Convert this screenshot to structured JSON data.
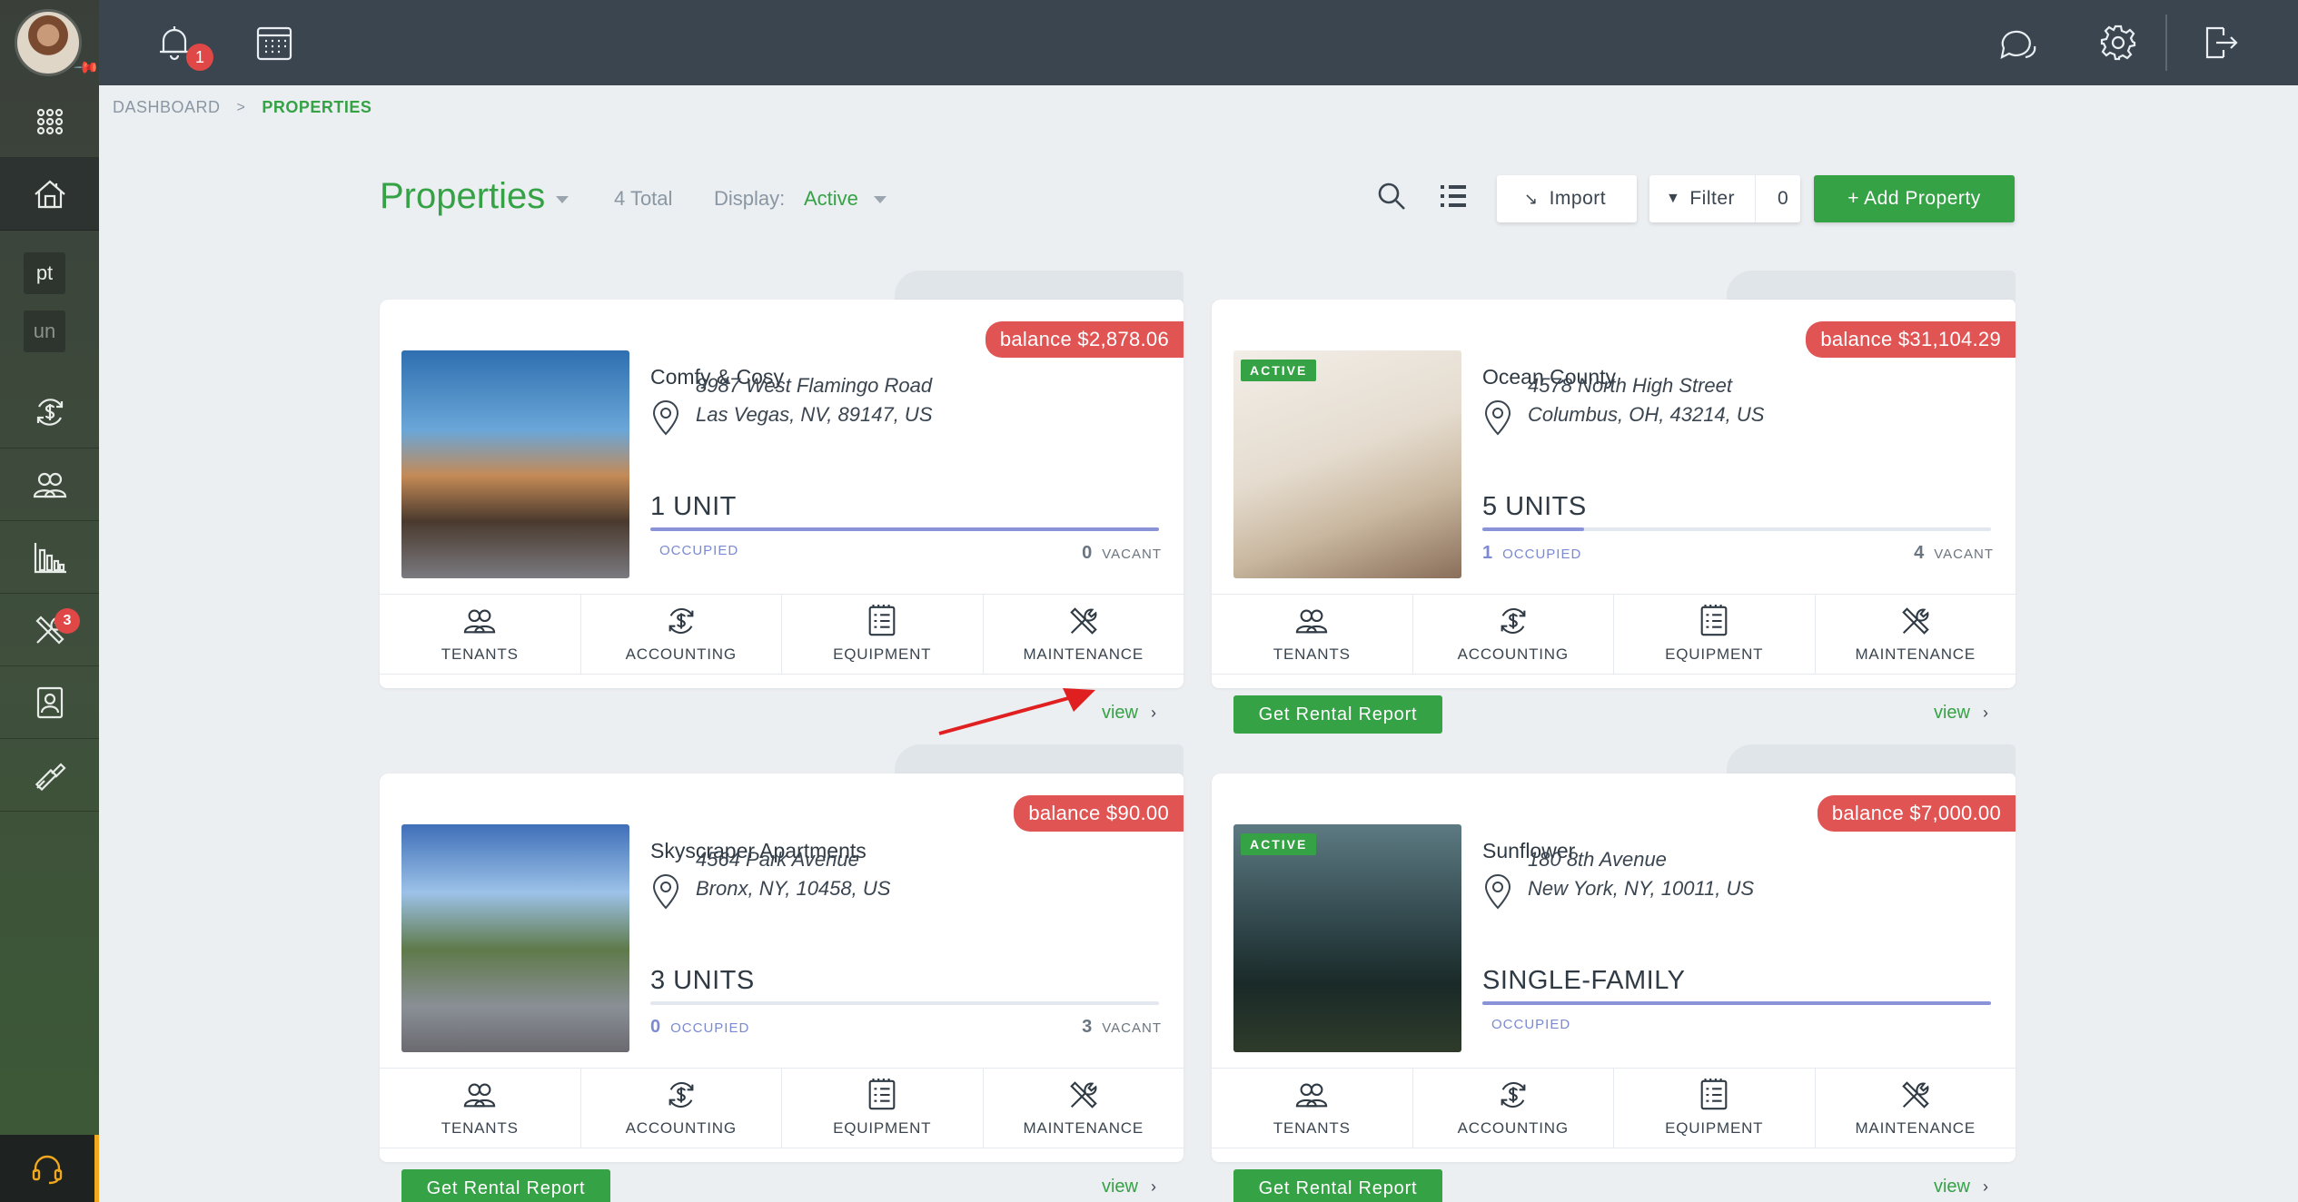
{
  "topbar": {
    "notifications_count": "1"
  },
  "sidebar": {
    "chips": [
      "pt",
      "un"
    ],
    "maintenance_count": "3",
    "items": [
      "apps-icon",
      "properties-icon",
      "accounting-icon",
      "people-icon",
      "reports-icon",
      "maintenance-icon",
      "documents-icon",
      "tools-icon"
    ]
  },
  "breadcrumb": {
    "home": "DASHBOARD",
    "separator": ">",
    "current": "PROPERTIES"
  },
  "header": {
    "title": "Properties",
    "total": "4 Total",
    "display_label": "Display:",
    "display_value": "Active",
    "import_label": "Import",
    "filter_label": "Filter",
    "filter_count": "0",
    "add_label": "+ Add Property"
  },
  "properties": [
    {
      "name": "Comfy & Cosy",
      "address_line1": "8987 West Flamingo Road",
      "address_line2": "Las Vegas, NV, 89147, US",
      "balance": "balance $2,878.06",
      "status_tag": "",
      "units": "1 UNIT",
      "occupied_count": "",
      "occupied_label": "OCCUPIED",
      "vacant_count": "0",
      "vacant_label": "VACANT",
      "occupancy": 1.0,
      "has_report": false,
      "report_label": "",
      "view_label": "view"
    },
    {
      "name": "Ocean County",
      "address_line1": "4578 North High Street",
      "address_line2": "Columbus, OH, 43214, US",
      "balance": "balance $31,104.29",
      "status_tag": "ACTIVE",
      "units": "5 UNITS",
      "occupied_count": "1",
      "occupied_label": "OCCUPIED",
      "vacant_count": "4",
      "vacant_label": "VACANT",
      "occupancy": 0.2,
      "has_report": true,
      "report_label": "Get Rental Report",
      "view_label": "view"
    },
    {
      "name": "Skyscraper Apartments",
      "address_line1": "4564 Park Avenue",
      "address_line2": "Bronx, NY, 10458, US",
      "balance": "balance $90.00",
      "status_tag": "",
      "units": "3 UNITS",
      "occupied_count": "0",
      "occupied_label": "OCCUPIED",
      "vacant_count": "3",
      "vacant_label": "VACANT",
      "occupancy": 0.0,
      "has_report": true,
      "report_label": "Get Rental Report",
      "view_label": "view"
    },
    {
      "name": "Sunflower",
      "address_line1": "180 8th Avenue",
      "address_line2": "New York, NY, 10011, US",
      "balance": "balance $7,000.00",
      "status_tag": "ACTIVE",
      "units": "SINGLE-FAMILY",
      "occupied_count": "",
      "occupied_label": "OCCUPIED",
      "vacant_count": "",
      "vacant_label": "",
      "occupancy": 1.0,
      "has_report": true,
      "report_label": "Get Rental Report",
      "view_label": "view"
    }
  ],
  "card_actions": [
    "TENANTS",
    "ACCOUNTING",
    "EQUIPMENT",
    "MAINTENANCE"
  ],
  "colors": {
    "accent": "#35a245",
    "balance": "#e05454",
    "topbar": "#3a4550",
    "occupancy_bar": "#8a93d8"
  }
}
